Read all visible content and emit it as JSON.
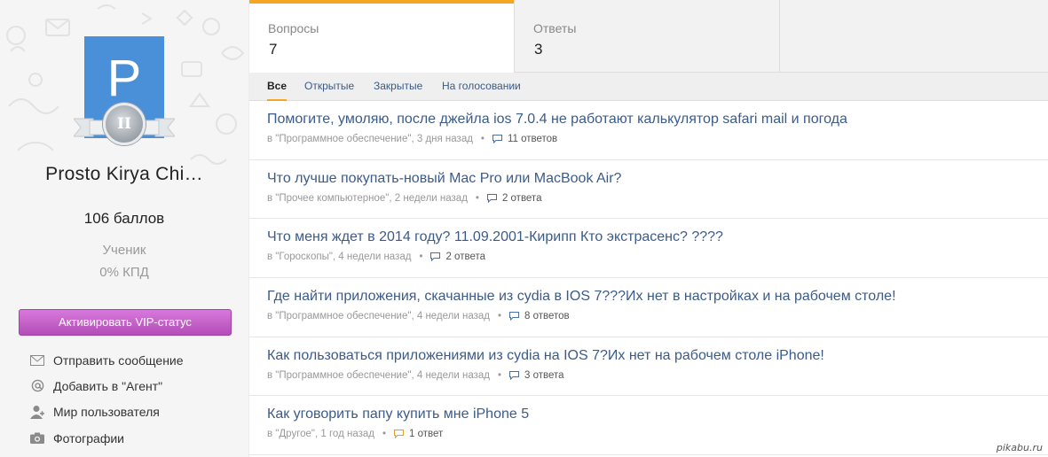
{
  "profile": {
    "avatar_letter": "P",
    "rank_numeral": "II",
    "name": "Prosto Kirya Chi…",
    "points": "106 баллов",
    "rank": "Ученик",
    "kpd": "0% КПД"
  },
  "sidebar": {
    "vip_button": "Активировать VIP-статус",
    "menu": [
      {
        "label": "Отправить сообщение",
        "icon": "envelope-icon"
      },
      {
        "label": "Добавить в \"Агент\"",
        "icon": "at-sign-icon"
      },
      {
        "label": "Мир пользователя",
        "icon": "user-icon"
      },
      {
        "label": "Фотографии",
        "icon": "camera-icon"
      }
    ]
  },
  "stats": {
    "questions_label": "Вопросы",
    "questions_value": "7",
    "answers_label": "Ответы",
    "answers_value": "3"
  },
  "filters": [
    "Все",
    "Открытые",
    "Закрытые",
    "На голосовании"
  ],
  "questions": [
    {
      "title": "Помогите, умоляю, после джейла ios 7.0.4 не работают калькулятор safari mail и погода",
      "category": "в \"Программное обеспечение\", 3 дня назад",
      "answers": "11 ответов"
    },
    {
      "title": "Что лучше покупать-новый Mac Pro или MacBook Air?",
      "category": "в \"Прочее компьютерное\", 2 недели назад",
      "answers": "2 ответа"
    },
    {
      "title": "Что меня ждет в 2014 году? 11.09.2001-Кирипп Кто экстрасенс? ????",
      "category": "в \"Гороскопы\", 4 недели назад",
      "answers": "2 ответа"
    },
    {
      "title": "Где найти приложения, скачанные из cydia в IOS 7???Их нет в настройках и на рабочем столе!",
      "category": "в \"Программное обеспечение\", 4 недели назад",
      "answers": "8 ответов"
    },
    {
      "title": "Как пользоваться приложениями из cydia на IOS 7?Их нет на рабочем столе iPhone!",
      "category": "в \"Программное обеспечение\", 4 недели назад",
      "answers": "3 ответа"
    },
    {
      "title": "Как уговорить папу купить мне iPhone 5",
      "category": "в \"Другое\", 1 год назад",
      "answers": "1 ответ"
    }
  ],
  "colors": {
    "accent": "#f5a623",
    "link": "#3b5b8a",
    "vip": "#c462c8",
    "avatar_bg": "#4a90d9"
  },
  "watermark": "pikabu.ru"
}
